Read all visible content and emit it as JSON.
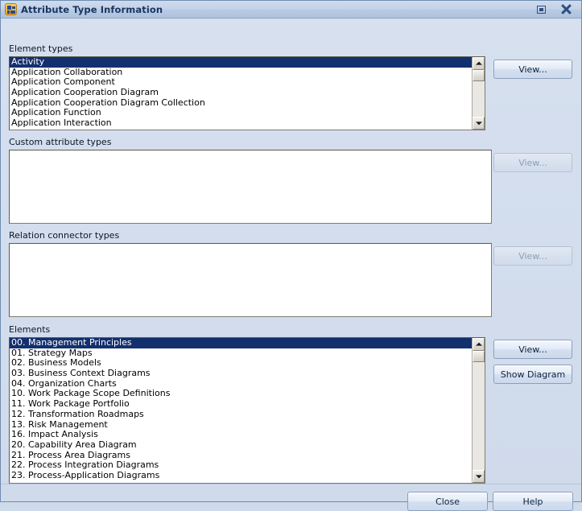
{
  "window": {
    "title": "Attribute Type Information",
    "icon": "app-icon",
    "restore_icon": "restore-icon",
    "close_icon": "close-icon"
  },
  "sections": {
    "element_types": {
      "label": "Element types",
      "items": [
        "Activity",
        "Application Collaboration",
        "Application Component",
        "Application Cooperation Diagram",
        "Application Cooperation Diagram Collection",
        "Application Function",
        "Application Interaction"
      ],
      "selected_index": 0,
      "view_label": "View...",
      "view_enabled": true
    },
    "custom_attribute_types": {
      "label": "Custom attribute types",
      "items": [],
      "view_label": "View...",
      "view_enabled": false
    },
    "relation_connector_types": {
      "label": "Relation connector types",
      "items": [],
      "view_label": "View...",
      "view_enabled": false
    },
    "elements": {
      "label": "Elements",
      "items": [
        "00. Management Principles",
        "01. Strategy Maps",
        "02. Business Models",
        "03. Business Context Diagrams",
        "04. Organization Charts",
        "10. Work Package Scope Definitions",
        "11. Work Package Portfolio",
        "12. Transformation Roadmaps",
        "13. Risk Management",
        "16. Impact Analysis",
        "20. Capability Area Diagram",
        "21. Process Area Diagrams",
        "22. Process Integration Diagrams",
        "23. Process-Application Diagrams"
      ],
      "selected_index": 0,
      "view_label": "View...",
      "show_diagram_label": "Show Diagram",
      "view_enabled": true
    }
  },
  "footer": {
    "close_label": "Close",
    "help_label": "Help"
  },
  "colors": {
    "selection": "#13306e",
    "window_bg": "#cfdaeb",
    "titlebar_text": "#19355f"
  }
}
